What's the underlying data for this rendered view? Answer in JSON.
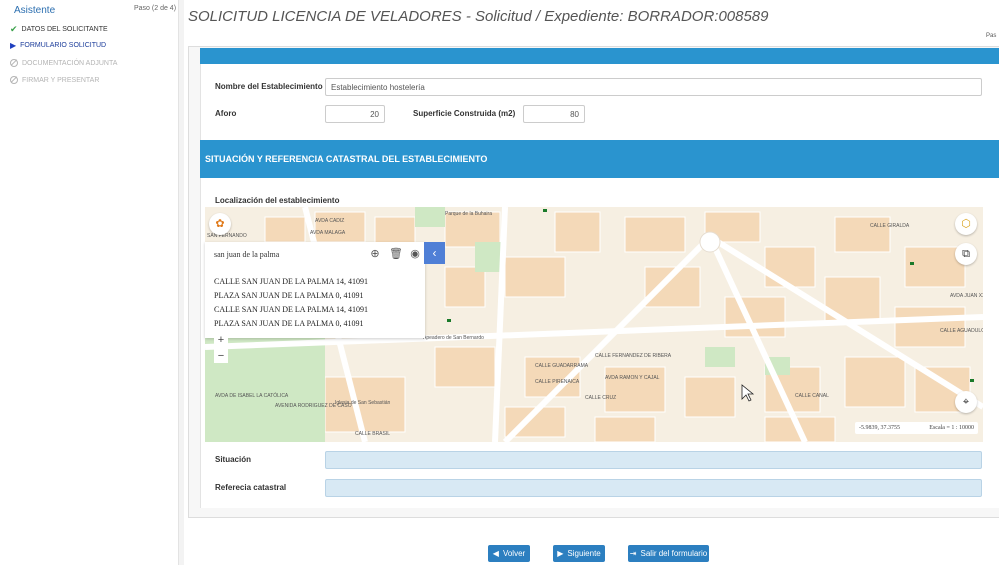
{
  "sidebar": {
    "title": "Asistente",
    "step": "Paso (2 de 4)",
    "items": [
      {
        "label": "DATOS DEL SOLICITANTE",
        "state": "done"
      },
      {
        "label": "FORMULARIO SOLICITUD",
        "state": "active"
      },
      {
        "label": "DOCUMENTACIÓN ADJUNTA",
        "state": "disabled"
      },
      {
        "label": "FIRMAR Y PRESENTAR",
        "state": "disabled"
      }
    ]
  },
  "header": {
    "title": "SOLICITUD LICENCIA DE VELADORES - Solicitud / Expediente: BORRADOR:008589",
    "step_short": "Pas"
  },
  "form": {
    "nombre_label": "Nombre del Establecimiento",
    "nombre_value": "Establecimiento hostelería",
    "aforo_label": "Aforo",
    "aforo_value": "20",
    "superficie_label": "Superficie Construida (m2)",
    "superficie_value": "80",
    "section_title": "SITUACIÓN Y REFERENCIA CATASTRAL DEL ESTABLECIMIENTO",
    "localizacion_label": "Localización del establecimiento",
    "situacion_label": "Situación",
    "situacion_value": "",
    "referencia_label": "Referecia catastral",
    "referencia_value": ""
  },
  "map": {
    "search_query": "san juan de la palma",
    "results": [
      "CALLE SAN JUAN DE LA PALMA 14, 41091",
      "PLAZA SAN JUAN DE LA PALMA 0, 41091",
      "CALLE SAN JUAN DE LA PALMA 14, 41091",
      "PLAZA SAN JUAN DE LA PALMA 0, 41091"
    ],
    "zoom_in": "+",
    "zoom_out": "−",
    "coordinates": "-5.9839, 37.3755",
    "scale": "Escala = 1 : 10000",
    "streets": [
      "AVDA CADIZ",
      "AVDA MALAGA",
      "SAN FERNANDO",
      "CALLE FERNANDEZ DE RIBERA",
      "CALLE GUADARRAMA",
      "AVDA RAMON Y CAJAL",
      "CALLE PIRENAICA",
      "CALLE BRASIL",
      "AVDA DE ISABEL LA CATÓLICA",
      "AVENIDA RODRIGUEZ DE CASO",
      "CALLE CRUZ",
      "CALLE CANAL",
      "CALLE AGUADULCE",
      "AVDA JUAN XXIII",
      "CALLE GIRALDA",
      "Iglesia de San Sebastián",
      "Apeadero de San Bernardo",
      "Parque de la Buhaira"
    ]
  },
  "buttons": {
    "volver": "Volver",
    "siguiente": "Siguiente",
    "salir": "Salir del formulario"
  },
  "colors": {
    "accent": "#2a94cf",
    "button": "#2c7fc0",
    "done": "#3aa14a",
    "active": "#1f3fbf"
  }
}
